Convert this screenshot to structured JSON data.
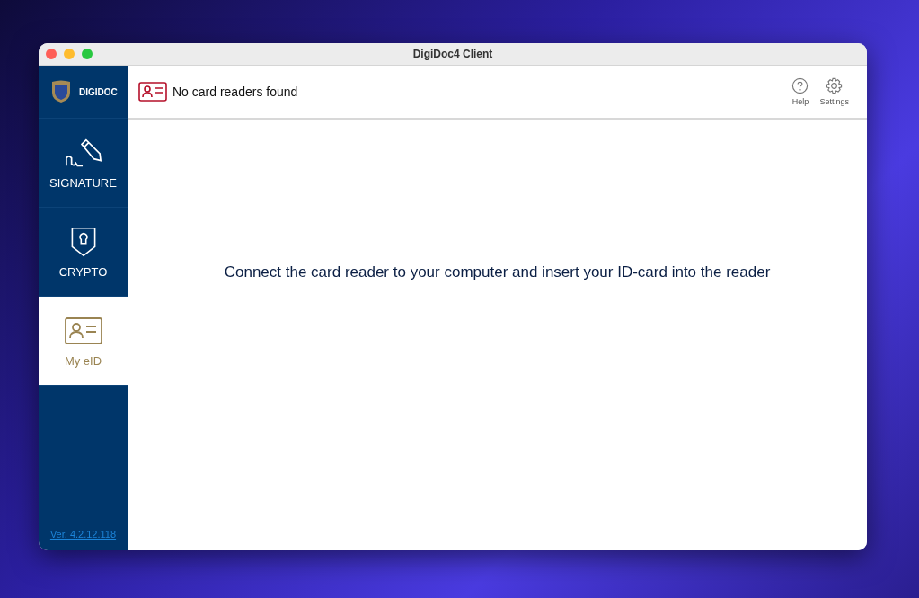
{
  "window": {
    "title": "DigiDoc4 Client"
  },
  "sidebar": {
    "logo_text": "DIGIDOC",
    "items": [
      {
        "kind": "signature",
        "label": "SIGNATURE",
        "selected": false
      },
      {
        "kind": "crypto",
        "label": "CRYPTO",
        "selected": false
      },
      {
        "kind": "eid",
        "label": "My eID",
        "selected": true
      }
    ],
    "version": "Ver. 4.2.12.118"
  },
  "header": {
    "status": "No card readers found",
    "buttons": [
      {
        "kind": "help",
        "label": "Help"
      },
      {
        "kind": "settings",
        "label": "Settings"
      }
    ]
  },
  "message": "Connect the card reader to your computer and insert your ID-card into the reader"
}
